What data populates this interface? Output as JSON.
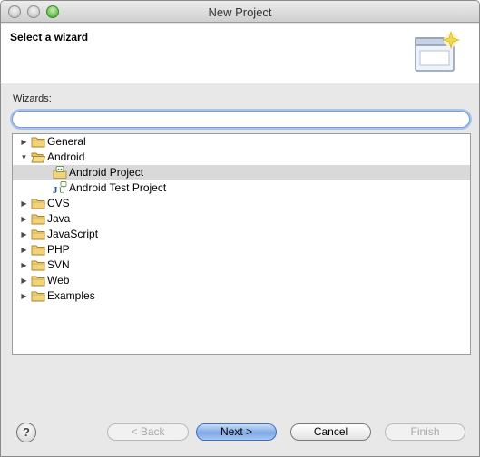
{
  "window": {
    "title": "New Project"
  },
  "header": {
    "title": "Select a wizard"
  },
  "wizards_label": "Wizards:",
  "filter": {
    "value": "",
    "placeholder": ""
  },
  "tree": [
    {
      "label": "General",
      "expanded": false,
      "icon": "folder-icon",
      "level": 0
    },
    {
      "label": "Android",
      "expanded": true,
      "icon": "folder-open-icon",
      "level": 0
    },
    {
      "label": "Android Project",
      "icon": "android-project-icon",
      "level": 1,
      "selected": true
    },
    {
      "label": "Android Test Project",
      "icon": "junit-test-icon",
      "level": 1
    },
    {
      "label": "CVS",
      "expanded": false,
      "icon": "folder-icon",
      "level": 0
    },
    {
      "label": "Java",
      "expanded": false,
      "icon": "folder-icon",
      "level": 0
    },
    {
      "label": "JavaScript",
      "expanded": false,
      "icon": "folder-icon",
      "level": 0
    },
    {
      "label": "PHP",
      "expanded": false,
      "icon": "folder-icon",
      "level": 0
    },
    {
      "label": "SVN",
      "expanded": false,
      "icon": "folder-icon",
      "level": 0
    },
    {
      "label": "Web",
      "expanded": false,
      "icon": "folder-icon",
      "level": 0
    },
    {
      "label": "Examples",
      "expanded": false,
      "icon": "folder-icon",
      "level": 0
    }
  ],
  "buttons": {
    "help": "?",
    "back": "< Back",
    "next": "Next >",
    "cancel": "Cancel",
    "finish": "Finish"
  },
  "colors": {
    "selection": "#d9d9d9",
    "default_button": "#7ea8e6",
    "focus_ring": "#a7c3ee"
  }
}
